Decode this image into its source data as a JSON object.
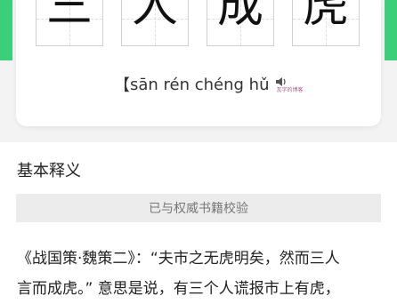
{
  "header": {
    "characters": [
      "三",
      "人",
      "成",
      "虎"
    ],
    "pinyin_prefix": "【",
    "pinyin": "sān rén chéng hǔ",
    "pinyin_suffix": "】",
    "speaker_icon": "speaker-icon",
    "watermark": " 瓦字的博客"
  },
  "section": {
    "title": "基本释义"
  },
  "verify": {
    "label": "已与权威书籍校验"
  },
  "explanation": {
    "lines": [
      "《战国策·魏策二》：“夫市之无虎明矣，然而三人",
      "言而成虎。” 意思是说，有三个人谎报市上有虎，"
    ]
  },
  "colors": {
    "accent": "#3ccf7a",
    "background": "#f3f3f3",
    "verify_bg": "#ececec"
  }
}
